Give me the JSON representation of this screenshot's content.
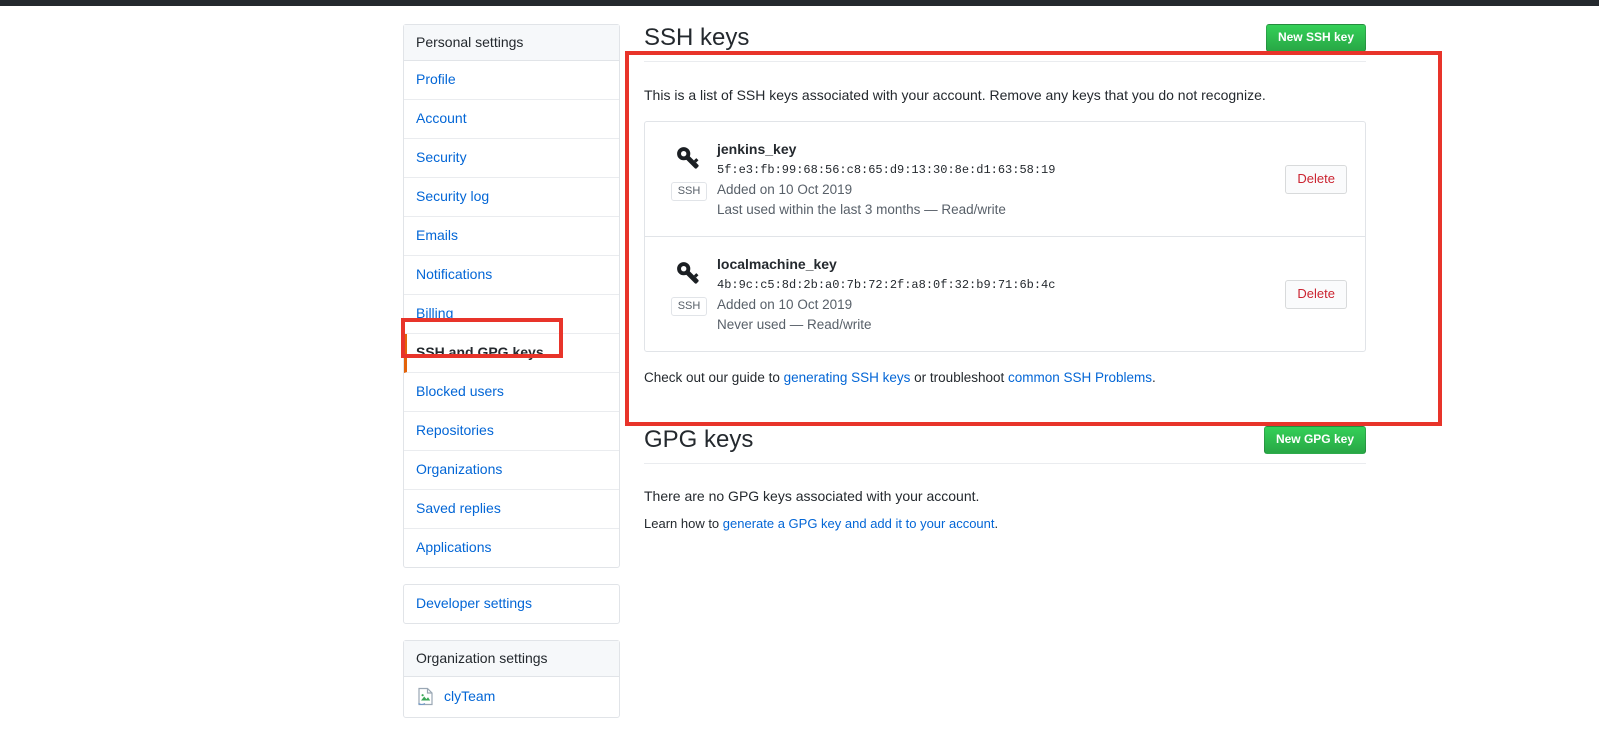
{
  "sidebar": {
    "personal": {
      "heading": "Personal settings",
      "items": [
        {
          "label": "Profile",
          "selected": false
        },
        {
          "label": "Account",
          "selected": false
        },
        {
          "label": "Security",
          "selected": false
        },
        {
          "label": "Security log",
          "selected": false
        },
        {
          "label": "Emails",
          "selected": false
        },
        {
          "label": "Notifications",
          "selected": false
        },
        {
          "label": "Billing",
          "selected": false
        },
        {
          "label": "SSH and GPG keys",
          "selected": true
        },
        {
          "label": "Blocked users",
          "selected": false
        },
        {
          "label": "Repositories",
          "selected": false
        },
        {
          "label": "Organizations",
          "selected": false
        },
        {
          "label": "Saved replies",
          "selected": false
        },
        {
          "label": "Applications",
          "selected": false
        }
      ]
    },
    "developer": {
      "label": "Developer settings"
    },
    "organization": {
      "heading": "Organization settings",
      "items": [
        {
          "label": "clyTeam",
          "icon": "broken-image-icon"
        }
      ]
    }
  },
  "ssh_section": {
    "title": "SSH keys",
    "new_key_button": "New SSH key",
    "description": "This is a list of SSH keys associated with your account. Remove any keys that you do not recognize.",
    "keys": [
      {
        "name": "jenkins_key",
        "fingerprint": "5f:e3:fb:99:68:56:c8:65:d9:13:30:8e:d1:63:58:19",
        "added": "Added on 10 Oct 2019",
        "usage": "Last used within the last 3 months — Read/write",
        "badge": "SSH",
        "delete_label": "Delete"
      },
      {
        "name": "localmachine_key",
        "fingerprint": "4b:9c:c5:8d:2b:a0:7b:72:2f:a8:0f:32:b9:71:6b:4c",
        "added": "Added on 10 Oct 2019",
        "usage": "Never used — Read/write",
        "badge": "SSH",
        "delete_label": "Delete"
      }
    ],
    "help": {
      "prefix": "Check out our guide to ",
      "link1": "generating SSH keys",
      "middle": " or troubleshoot ",
      "link2": "common SSH Problems",
      "suffix": "."
    }
  },
  "gpg_section": {
    "title": "GPG keys",
    "new_key_button": "New GPG key",
    "empty_text": "There are no GPG keys associated with your account.",
    "learn": {
      "prefix": "Learn how to ",
      "link": "generate a GPG key and add it to your account",
      "suffix": "."
    }
  },
  "annotations": {
    "color": "#e8342a",
    "boxes": [
      {
        "name": "ssh-and-gpg-keys-menu-highlight"
      },
      {
        "name": "ssh-keys-panel-highlight"
      }
    ]
  }
}
